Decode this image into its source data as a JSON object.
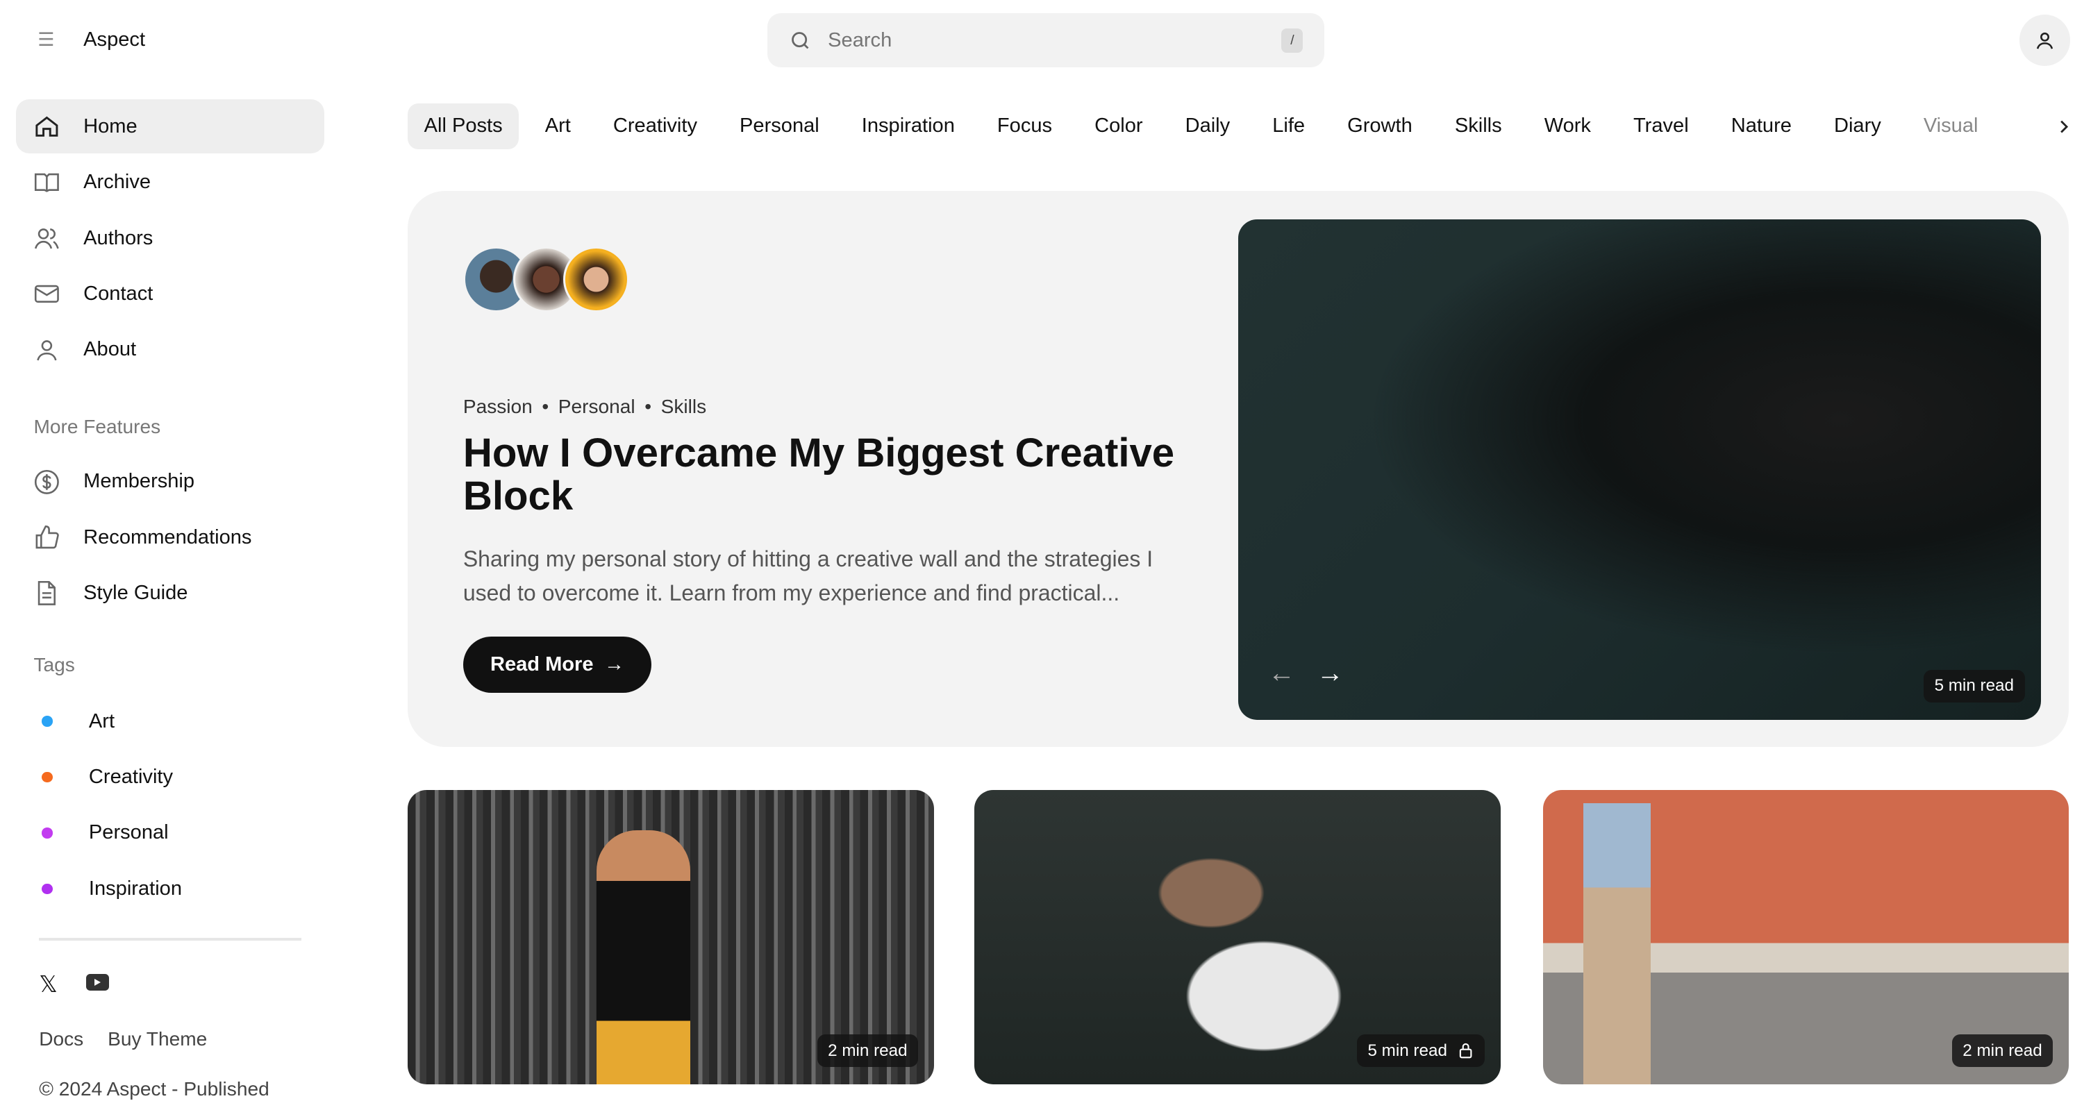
{
  "header": {
    "brand": "Aspect",
    "search_placeholder": "Search",
    "search_shortcut": "/"
  },
  "sidebar": {
    "nav": [
      {
        "label": "Home",
        "icon": "home-icon"
      },
      {
        "label": "Archive",
        "icon": "book-icon"
      },
      {
        "label": "Authors",
        "icon": "users-icon"
      },
      {
        "label": "Contact",
        "icon": "mail-icon"
      },
      {
        "label": "About",
        "icon": "user-icon"
      }
    ],
    "more_title": "More Features",
    "more": [
      {
        "label": "Membership",
        "icon": "dollar-icon"
      },
      {
        "label": "Recommendations",
        "icon": "thumbs-up-icon"
      },
      {
        "label": "Style Guide",
        "icon": "document-icon"
      }
    ],
    "tags_title": "Tags",
    "tags": [
      {
        "label": "Art",
        "color": "#2aa3f5"
      },
      {
        "label": "Creativity",
        "color": "#f56a1e"
      },
      {
        "label": "Personal",
        "color": "#c23cf0"
      },
      {
        "label": "Inspiration",
        "color": "#b030f0"
      }
    ],
    "footer": {
      "docs": "Docs",
      "buy": "Buy Theme",
      "copyright": "© 2024 Aspect - Published"
    }
  },
  "tabs": [
    "All Posts",
    "Art",
    "Creativity",
    "Personal",
    "Inspiration",
    "Focus",
    "Color",
    "Daily",
    "Life",
    "Growth",
    "Skills",
    "Work",
    "Travel",
    "Nature",
    "Diary",
    "Visual"
  ],
  "hero": {
    "categories": [
      "Passion",
      "Personal",
      "Skills"
    ],
    "title": "How I Overcame My Biggest Creative Block",
    "excerpt": "Sharing my personal story of hitting a creative wall and the strategies I used to overcome it. Learn from my experience and find practical...",
    "button": "Read More",
    "read_time": "5 min read"
  },
  "cards": [
    {
      "read_time": "2 min read",
      "locked": false
    },
    {
      "read_time": "5 min read",
      "locked": true
    },
    {
      "read_time": "2 min read",
      "locked": false
    }
  ]
}
